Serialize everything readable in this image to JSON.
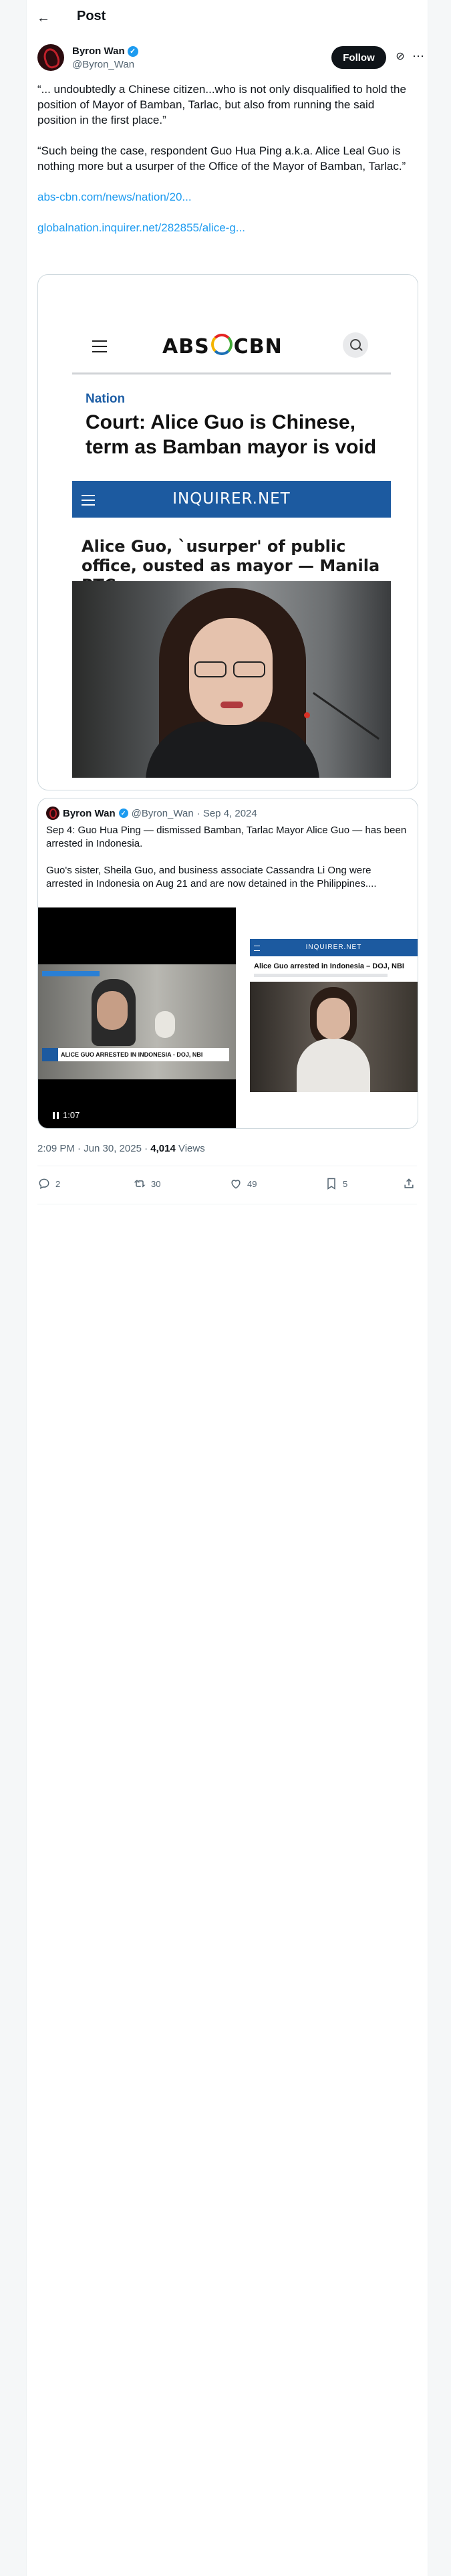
{
  "page": {
    "title": "Post"
  },
  "author": {
    "name": "Byron Wan",
    "handle": "@Byron_Wan",
    "follow_label": "Follow"
  },
  "post": {
    "paragraphs": [
      "“... undoubtedly a Chinese citizen...who is not only disqualified to hold the position of Mayor of Bamban, Tarlac, but also from running the said position in the first place.”",
      "“Such being the case, respondent Guo Hua Ping a.k.a. Alice Leal Guo is nothing more but a usurper of the Office of the Mayor of Bamban, Tarlac.”"
    ],
    "links": [
      "abs-cbn.com/news/nation/20...",
      "globalnation.inquirer.net/282855/alice-g..."
    ]
  },
  "media_card": {
    "kicker": "Nation",
    "headline": "Court: Alice Guo is Chinese, term as Bamban mayor is void",
    "inquirer_label": "INQUIRER.NET",
    "inquirer_headline": "Alice Guo, `usurper' of public office, ousted as mayor — Manila RTC"
  },
  "quote": {
    "name": "Byron Wan",
    "handle": "@Byron_Wan",
    "date": "· Sep 4, 2024",
    "paragraphs": [
      "Sep 4: Guo Hua Ping — dismissed Bamban, Tarlac Mayor Alice Guo — has been arrested in Indonesia.",
      "Guo's sister, Sheila Guo, and business associate Cassandra Li Ong were arrested in Indonesia on Aug 21 and are now detained in the Philippines...."
    ],
    "video": {
      "duration": "1:07",
      "lower_third": "ALICE GUO ARRESTED IN INDONESIA - DOJ, NBI"
    },
    "thumb": {
      "site": "INQUIRER.NET",
      "headline": "Alice Guo arrested in Indonesia – DOJ, NBI"
    }
  },
  "meta": {
    "time": "2:09 PM · Jun 30, 2025 · ",
    "views_count": "4,014",
    "views_label": " Views"
  },
  "actions": {
    "replies": "2",
    "reposts": "30",
    "likes": "49",
    "bookmarks": "5"
  }
}
